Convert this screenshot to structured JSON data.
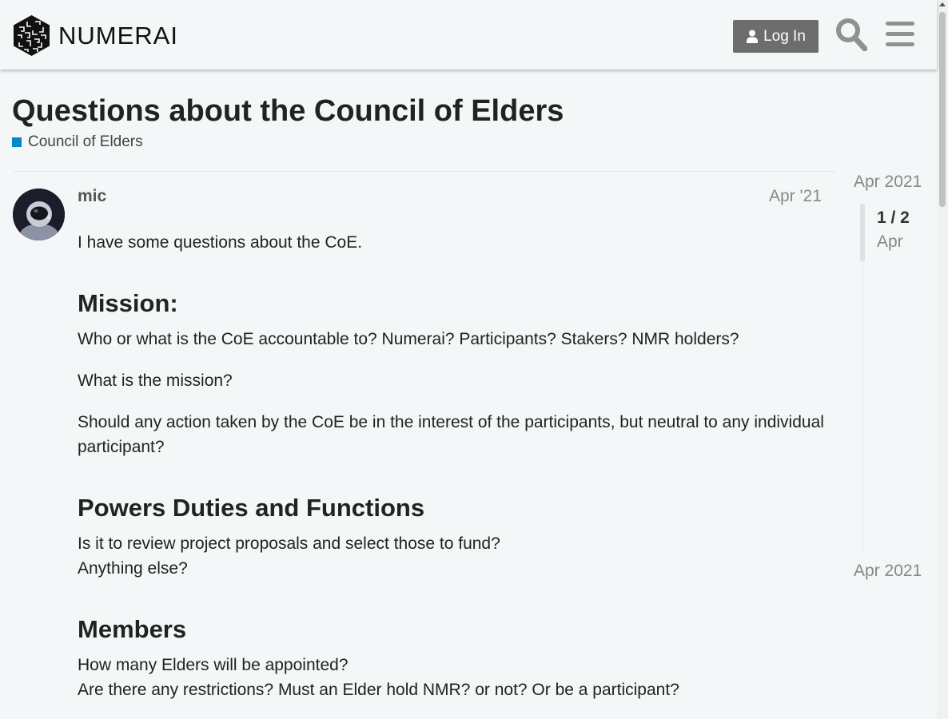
{
  "header": {
    "brand": "NUMERAI",
    "login_label": "Log In",
    "icons": {
      "logo": "numerai-cube-logo",
      "login": "user-icon",
      "search": "search-icon",
      "menu": "hamburger-menu-icon"
    }
  },
  "topic": {
    "title": "Questions about the Council of Elders",
    "category": "Council of Elders",
    "category_color": "#0088cc"
  },
  "post": {
    "author": "mic",
    "date": "Apr '21",
    "intro": "I have some questions about the CoE.",
    "sections": [
      {
        "heading": "Mission:",
        "paragraphs": [
          [
            "Who or what is the CoE accountable to? Numerai? Participants? Stakers? NMR holders?"
          ],
          [
            "What is the mission?"
          ],
          [
            "Should any action taken by the CoE be in the interest of the participants, but neutral to any individual participant?"
          ]
        ]
      },
      {
        "heading": "Powers Duties and Functions",
        "paragraphs": [
          [
            "Is it to review project proposals and select those to fund?",
            "Anything else?"
          ]
        ]
      },
      {
        "heading": "Members",
        "paragraphs": [
          [
            "How many Elders will be appointed?",
            "Are there any restrictions? Must an Elder hold NMR? or not? Or be a participant?"
          ]
        ]
      }
    ]
  },
  "timeline": {
    "start_date": "Apr 2021",
    "position": "1 / 2",
    "current_date": "Apr",
    "end_date": "Apr 2021"
  }
}
